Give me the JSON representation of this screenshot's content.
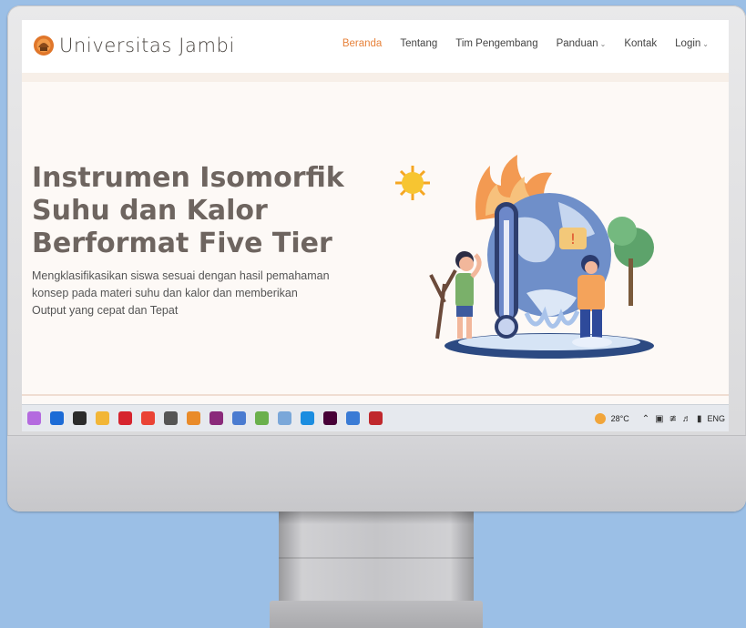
{
  "brand": {
    "name": "Universitas Jambi"
  },
  "nav": {
    "items": [
      {
        "label": "Beranda",
        "active": true
      },
      {
        "label": "Tentang"
      },
      {
        "label": "Tim Pengembang"
      },
      {
        "label": "Panduan",
        "dropdown": true
      },
      {
        "label": "Kontak"
      },
      {
        "label": "Login",
        "dropdown": true
      }
    ],
    "accent_color": "#e7823b"
  },
  "hero": {
    "title_lines": [
      "Instrumen Isomorfik",
      "Suhu dan Kalor",
      "Berformat Five Tier"
    ],
    "description_lines": [
      "Mengklasifikasikan siswa sesuai dengan hasil pemahaman",
      "konsep pada materi suhu dan kalor dan memberikan",
      "Output yang cepat dan Tepat"
    ]
  },
  "taskbar": {
    "apps": [
      {
        "icon": "copilot-icon",
        "color": "#b46adf"
      },
      {
        "icon": "store-icon",
        "color": "#1c6bd6"
      },
      {
        "icon": "terminal-icon",
        "color": "#2b2b2b"
      },
      {
        "icon": "file-explorer-icon",
        "color": "#f2b637"
      },
      {
        "icon": "opera-icon",
        "color": "#d6242e"
      },
      {
        "icon": "chrome-icon",
        "color": "#ea4335"
      },
      {
        "icon": "calculator-icon",
        "color": "#555555"
      },
      {
        "icon": "app-orange-icon",
        "color": "#e98b2a"
      },
      {
        "icon": "winrar-icon",
        "color": "#8a2a7a"
      },
      {
        "icon": "app-blue-icon",
        "color": "#4a7bd0"
      },
      {
        "icon": "notepad-icon",
        "color": "#6ab04c"
      },
      {
        "icon": "paint-icon",
        "color": "#7aa7d9"
      },
      {
        "icon": "edge-icon",
        "color": "#1b8de0"
      },
      {
        "icon": "dreamweaver-icon",
        "color": "#470137"
      },
      {
        "icon": "globe-icon",
        "color": "#3a7bd5"
      },
      {
        "icon": "mendeley-icon",
        "color": "#c0282d"
      }
    ],
    "weather": "28°C",
    "language": "ENG"
  }
}
